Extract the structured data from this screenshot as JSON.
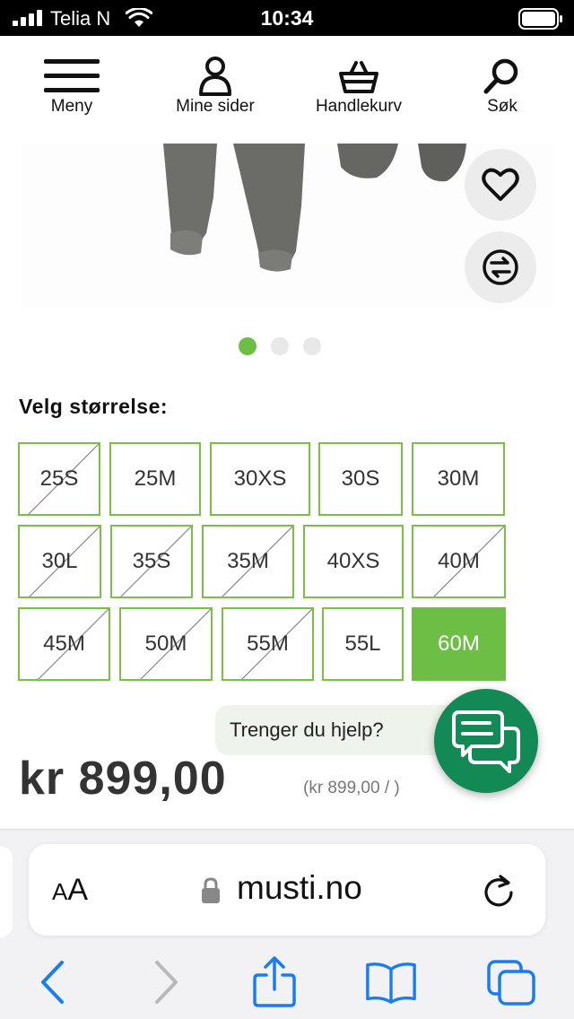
{
  "status_bar": {
    "carrier": "Telia N",
    "time": "10:34"
  },
  "header": {
    "nav": [
      {
        "label": "Meny",
        "icon": "menu-icon"
      },
      {
        "label": "Mine sider",
        "icon": "user-icon"
      },
      {
        "label": "Handlekurv",
        "icon": "basket-icon"
      },
      {
        "label": "Søk",
        "icon": "search-icon"
      }
    ]
  },
  "product": {
    "image_dots": {
      "count": 3,
      "active": 0
    },
    "favorite_icon": "heart-icon",
    "compare_icon": "compare-icon",
    "size_title": "Velg størrelse:",
    "sizes": [
      {
        "label": "25S",
        "available": false
      },
      {
        "label": "25M",
        "available": true
      },
      {
        "label": "30XS",
        "available": true
      },
      {
        "label": "30S",
        "available": true
      },
      {
        "label": "30M",
        "available": true
      },
      {
        "label": "30L",
        "available": false
      },
      {
        "label": "35S",
        "available": false
      },
      {
        "label": "35M",
        "available": false
      },
      {
        "label": "40XS",
        "available": true
      },
      {
        "label": "40M",
        "available": false
      },
      {
        "label": "45M",
        "available": false
      },
      {
        "label": "50M",
        "available": false
      },
      {
        "label": "55M",
        "available": false
      },
      {
        "label": "55L",
        "available": true
      },
      {
        "label": "60M",
        "available": true,
        "selected": true
      }
    ],
    "price": "kr 899,00",
    "unit_price": "(kr 899,00 / )"
  },
  "chat": {
    "prompt": "Trenger du hjelp?",
    "icon": "chat-icon"
  },
  "browser": {
    "aa_label_small": "A",
    "aa_label_large": "A",
    "domain": "musti.no",
    "toolbar": [
      "back-icon",
      "forward-icon",
      "share-icon",
      "bookmarks-icon",
      "tabs-icon"
    ]
  },
  "colors": {
    "accent_green": "#6cbf44",
    "chat_green": "#138a55",
    "ios_blue": "#1a7cf5"
  }
}
